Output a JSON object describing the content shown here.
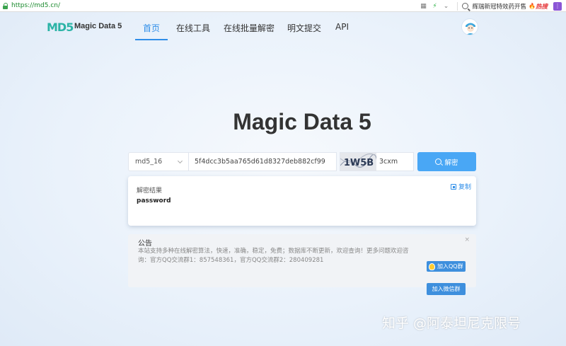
{
  "browser": {
    "url": "https://md5.cn/",
    "search_text": "辉瑞新冠特效药开售",
    "hot_label": "热搜"
  },
  "header": {
    "logo_mark": "MD5",
    "logo_text": "Magic Data 5",
    "nav": [
      {
        "label": "首页",
        "active": true
      },
      {
        "label": "在线工具",
        "active": false
      },
      {
        "label": "在线批量解密",
        "active": false
      },
      {
        "label": "明文提交",
        "active": false
      },
      {
        "label": "API",
        "active": false
      }
    ]
  },
  "hero": {
    "title": "Magic Data 5"
  },
  "search": {
    "algorithm": "md5_16",
    "hash_value": "5f4dcc3b5aa765d61d8327deb882cf99",
    "captcha_image_text": "1W5B",
    "captcha_value": "3cxm",
    "decrypt_label": "解密"
  },
  "result": {
    "label": "解密结果",
    "value": "password",
    "copy_label": "复制"
  },
  "notice": {
    "title": "公告",
    "close": "×",
    "body": "本站支持多种在线解密算法，快速，准确，稳定，免费；数据库不断更新，欢迎查询！更多问题欢迎咨询：官方QQ交流群1：857548361，官方QQ交流群2：280409281",
    "qq_label": "加入QQ群",
    "wechat_label": "加入微信群"
  },
  "watermark": "知乎 @阿泰坦尼克限号",
  "colors": {
    "accent": "#2f8ee8",
    "button": "#49a7f5",
    "join_button": "#3e8fdd",
    "url_green": "#1a8a2d"
  }
}
